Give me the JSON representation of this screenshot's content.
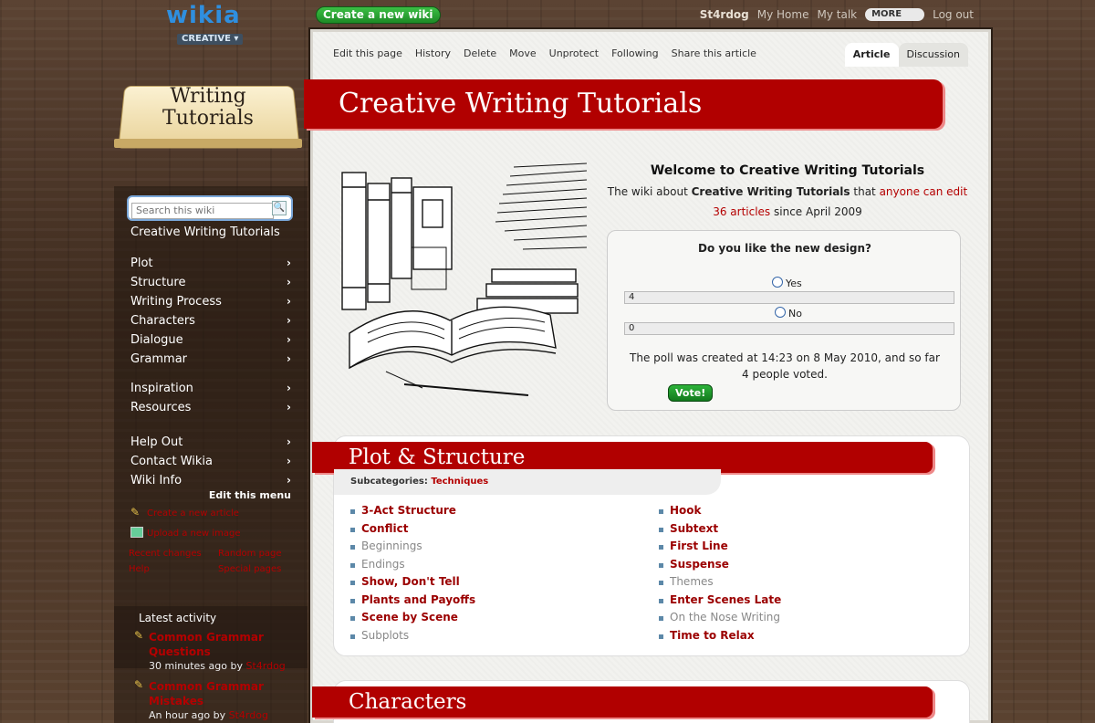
{
  "header": {
    "logo_word": "wikia",
    "logo_sub": "CREATIVE ▾",
    "create_wiki": "Create a new wiki",
    "username": "St4rdog",
    "my_home": "My Home",
    "my_talk": "My talk",
    "more": "MORE",
    "logout": "Log out"
  },
  "sidebar": {
    "logo_title_line1": "Writing",
    "logo_title_line2": "Tutorials",
    "search_placeholder": "Search this wiki",
    "wiki_name": "Creative Writing Tutorials",
    "nav_group1": [
      "Plot",
      "Structure",
      "Writing Process",
      "Characters",
      "Dialogue",
      "Grammar"
    ],
    "nav_group2": [
      "Inspiration",
      "Resources"
    ],
    "nav_group3": [
      "Help Out",
      "Contact Wikia",
      "Wiki Info"
    ],
    "chevron": "›",
    "edit_menu": "Edit this menu",
    "tools": {
      "create_article": "Create a new article",
      "upload_image": "Upload a new image",
      "special_changes": "Recent changes",
      "random_page": "Random page",
      "help": "Help",
      "special_pages": "Special pages"
    }
  },
  "activity": {
    "heading": "Latest activity",
    "items": [
      {
        "title": "Common Grammar Questions",
        "time": "30 minutes ago by",
        "user": "St4rdog"
      },
      {
        "title": "Common Grammar Mistakes",
        "time": "An hour ago by",
        "user": "St4rdog"
      }
    ]
  },
  "page": {
    "actions": [
      "Edit this page",
      "History",
      "Delete",
      "Move",
      "Unprotect",
      "Following",
      "Share this article"
    ],
    "tab_article": "Article",
    "tab_discussion": "Discussion",
    "title": "Creative Writing Tutorials"
  },
  "welcome": {
    "heading": "Welcome to Creative Writing Tutorials",
    "line1_pre": "The wiki about ",
    "line1_bold": "Creative Writing Tutorials",
    "line1_mid": " that ",
    "line1_link": "anyone can edit",
    "articles_link": "36 articles",
    "since": " since April 2009"
  },
  "poll": {
    "question": "Do you like the new design?",
    "options": [
      {
        "label": "Yes",
        "votes": "4"
      },
      {
        "label": "No",
        "votes": "0"
      }
    ],
    "note": "The poll was created at 14:23 on 8 May 2010, and so far 4 people voted.",
    "vote_button": "Vote!"
  },
  "plot_section": {
    "heading": "Plot & Structure",
    "subcat_label": "Subcategories: ",
    "subcat_value": "Techniques",
    "left_links": [
      {
        "text": "3-Act Structure",
        "style": "red"
      },
      {
        "text": "Conflict",
        "style": "red"
      },
      {
        "text": "Beginnings",
        "style": "gray"
      },
      {
        "text": "Endings",
        "style": "gray"
      },
      {
        "text": "Show, Don't Tell",
        "style": "red"
      },
      {
        "text": "Plants and Payoffs",
        "style": "red"
      },
      {
        "text": "Scene by Scene",
        "style": "red"
      },
      {
        "text": "Subplots",
        "style": "gray"
      }
    ],
    "right_links": [
      {
        "text": "Hook",
        "style": "red"
      },
      {
        "text": "Subtext",
        "style": "red"
      },
      {
        "text": "First Line",
        "style": "red"
      },
      {
        "text": "Suspense",
        "style": "red"
      },
      {
        "text": "Themes",
        "style": "gray"
      },
      {
        "text": "Enter Scenes Late",
        "style": "red"
      },
      {
        "text": "On the Nose Writing",
        "style": "gray"
      },
      {
        "text": "Time to Relax",
        "style": "red"
      }
    ]
  },
  "characters_section": {
    "heading": "Characters"
  }
}
